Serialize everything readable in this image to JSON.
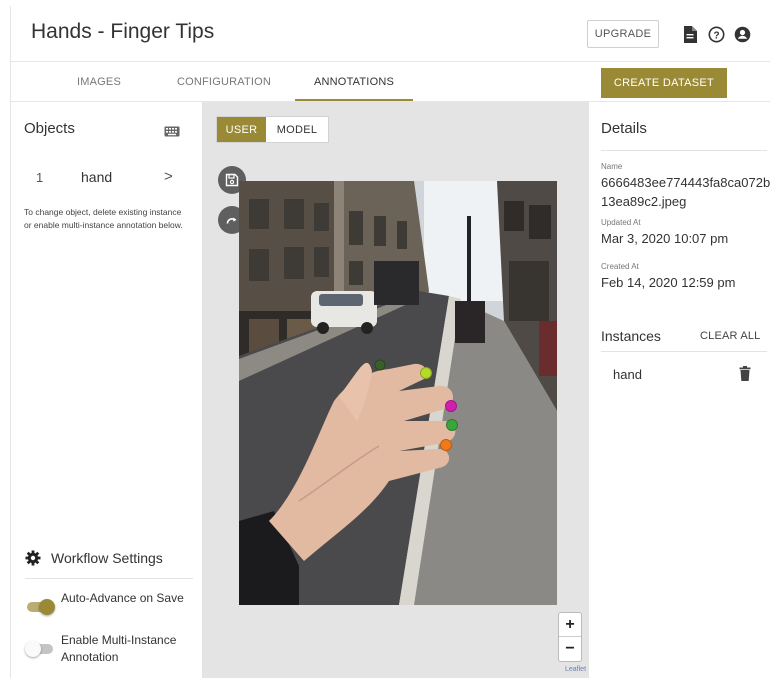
{
  "app": {
    "title": "Hands - Finger Tips"
  },
  "header": {
    "upgrade_label": "UPGRADE",
    "icons": [
      "document-icon",
      "help-icon",
      "account-icon"
    ]
  },
  "tabs": [
    {
      "label": "IMAGES",
      "active": false
    },
    {
      "label": "CONFIGURATION",
      "active": false
    },
    {
      "label": "ANNOTATIONS",
      "active": true
    }
  ],
  "create_dataset_label": "CREATE DATASET",
  "objects": {
    "title": "Objects",
    "items": [
      {
        "num": "1",
        "label": "hand"
      }
    ],
    "help_text": "To change object, delete existing instance or enable multi-instance annotation below."
  },
  "workflow": {
    "title": "Workflow Settings",
    "toggles": [
      {
        "label": "Auto-Advance on Save",
        "on": true
      },
      {
        "label": "Enable Multi-Instance Annotation",
        "on": false
      }
    ]
  },
  "annotator": {
    "mode_user": "USER",
    "mode_model": "MODEL",
    "active_mode": "USER",
    "zoom_in": "+",
    "zoom_out": "−",
    "attribution": "Leaflet"
  },
  "details": {
    "title": "Details",
    "name_label": "Name",
    "name_value": "6666483ee774443fa8ca072b13ea89c2.jpeg",
    "updated_label": "Updated At",
    "updated_value": "Mar 3, 2020 10:07 pm",
    "created_label": "Created At",
    "created_value": "Feb 14, 2020 12:59 pm"
  },
  "instances": {
    "title": "Instances",
    "clear_all": "CLEAR ALL",
    "items": [
      {
        "label": "hand"
      }
    ]
  },
  "colors": {
    "accent": "#9b8a35",
    "keypoints": [
      "#3b5e2a",
      "#b6d92b",
      "#d01fb0",
      "#3aa53a",
      "#f07a1a"
    ]
  }
}
